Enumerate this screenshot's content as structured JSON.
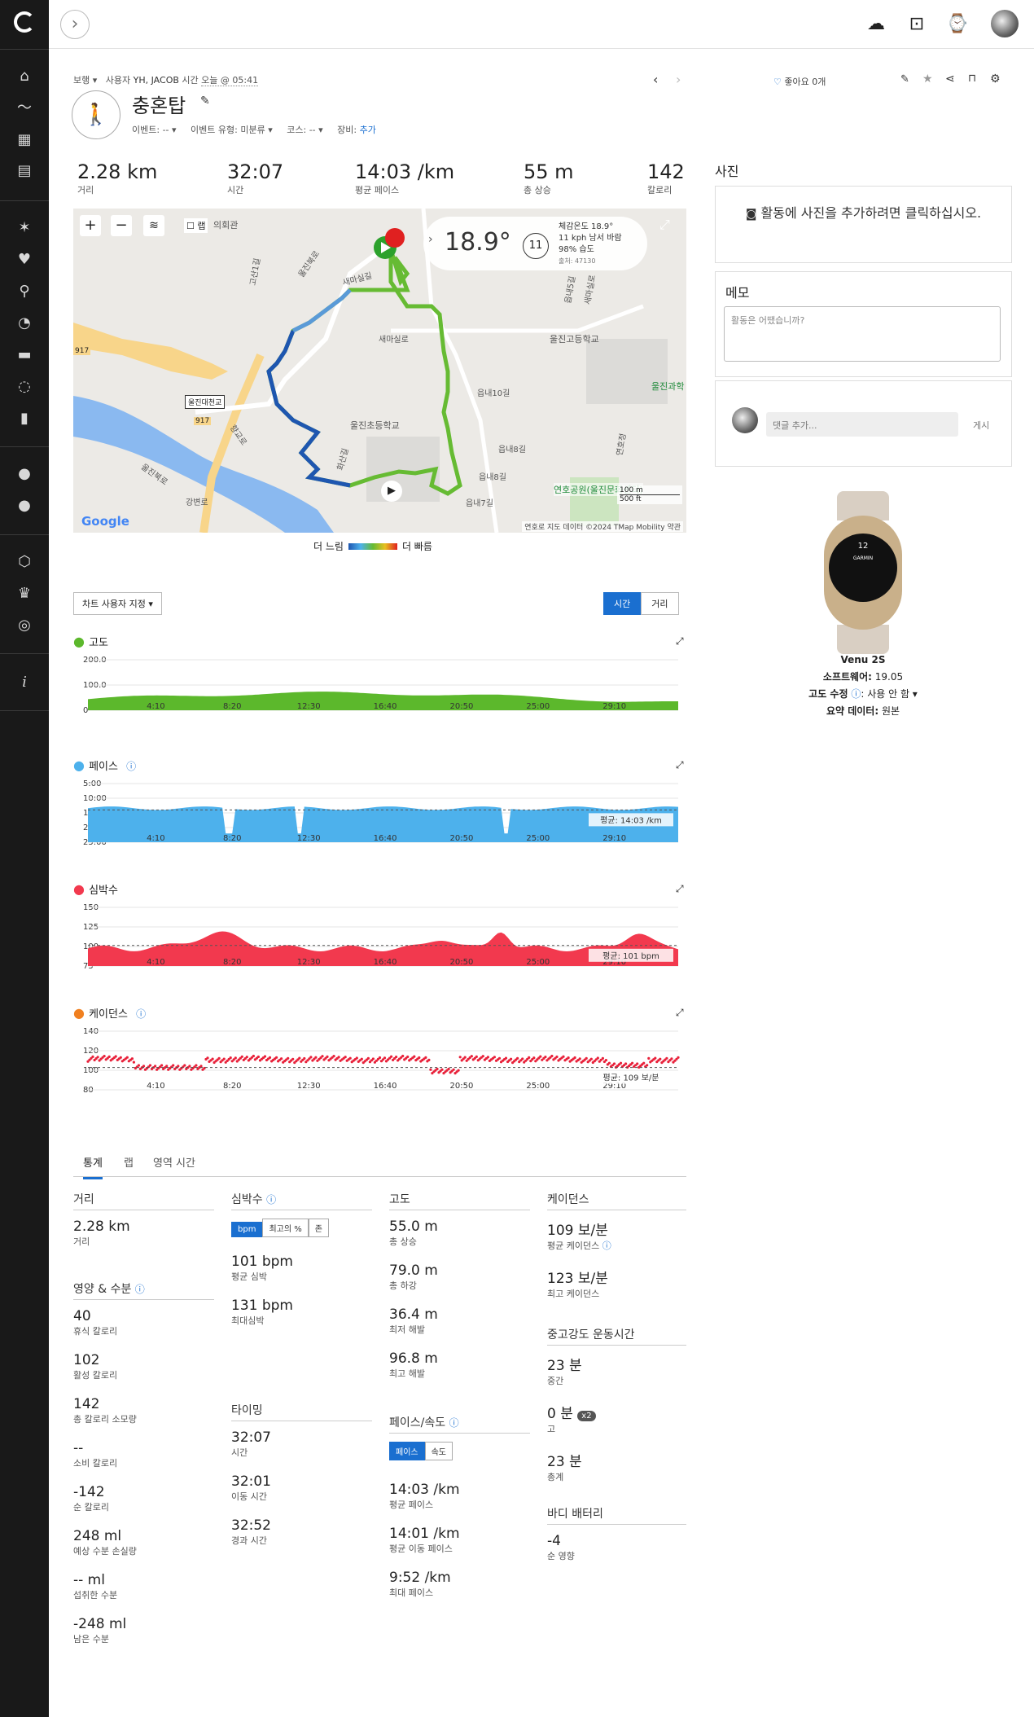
{
  "header": {
    "breadcrumb_type": "보행",
    "by_label": "사용자",
    "user": "YH, JACOB",
    "time_label": "시간",
    "time_value": "오늘 @ 05:41",
    "title": "충혼탑",
    "event_label": "이벤트:",
    "event_value": "--",
    "event_type_label": "이벤트 유형:",
    "event_type_value": "미분류",
    "course_label": "코스:",
    "course_value": "--",
    "gear_label": "장비:",
    "gear_value": "추가",
    "like_label": "좋아요 0개"
  },
  "stats": [
    {
      "value": "2.28 km",
      "label": "거리"
    },
    {
      "value": "32:07",
      "label": "시간"
    },
    {
      "value": "14:03 /km",
      "label": "평균 페이스"
    },
    {
      "value": "55 m",
      "label": "총 상승"
    },
    {
      "value": "142",
      "label": "칼로리"
    }
  ],
  "map": {
    "weather_temp": "18.9°",
    "weather_feels": "체감온도 18.9°",
    "weather_wind": "11 kph 남서 바람",
    "weather_humidity": "98% 습도",
    "weather_source": "출처: 47130",
    "wind_speed": "11",
    "lap_label": "랩",
    "scale_m": "100 m",
    "scale_ft": "500 ft",
    "google": "Google",
    "attribution": "연호로   지도 데이터 ©2024 TMap Mobility   약관",
    "legend_slow": "더 느림",
    "legend_fast": "더 빠름",
    "places": [
      "의회관",
      "새마실로",
      "울진고등학교",
      "읍내10길",
      "울진초등학교",
      "읍내8길",
      "읍내8길",
      "읍내7길",
      "울진대천교",
      "연호공원(울진문화센터)",
      "울진과학",
      "917",
      "917",
      "고산1길",
      "울진북로",
      "새마실길",
      "읍내5길",
      "새마실로",
      "강변로",
      "울진북로",
      "연호정",
      "향교로",
      "화산길"
    ]
  },
  "chart_controls": {
    "customize": "차트 사용자 지정 ▾",
    "time": "시간",
    "distance": "거리"
  },
  "charts": {
    "x_ticks": [
      "4:10",
      "8:20",
      "12:30",
      "16:40",
      "20:50",
      "25:00",
      "29:10"
    ],
    "elevation": {
      "title": "고도",
      "y_ticks": [
        "200.0",
        "100.0",
        "0"
      ]
    },
    "pace": {
      "title": "페이스",
      "y_ticks": [
        "5:00",
        "10:00",
        "15:00",
        "20:00",
        "25:00"
      ],
      "avg": "평균: 14:03 /km"
    },
    "hr": {
      "title": "심박수",
      "y_ticks": [
        "150",
        "125",
        "100",
        "75"
      ],
      "avg": "평균: 101 bpm"
    },
    "cadence": {
      "title": "케이던스",
      "y_ticks": [
        "140",
        "120",
        "100",
        "80"
      ],
      "avg": "평균: 109 보/분"
    }
  },
  "tabs": {
    "stats": "통계",
    "laps": "랩",
    "zones": "영역 시간"
  },
  "summary": {
    "distance": {
      "head": "거리",
      "items": [
        {
          "v": "2.28 km",
          "l": "거리"
        }
      ]
    },
    "nutrition": {
      "head": "영양 & 수분",
      "items": [
        {
          "v": "40",
          "l": "휴식 칼로리"
        },
        {
          "v": "102",
          "l": "활성 칼로리"
        },
        {
          "v": "142",
          "l": "총 칼로리 소모량"
        },
        {
          "v": "--",
          "l": "소비 칼로리"
        },
        {
          "v": "-142",
          "l": "순 칼로리"
        },
        {
          "v": "248 ml",
          "l": "예상 수분 손실량"
        },
        {
          "v": "-- ml",
          "l": "섭취한 수분"
        },
        {
          "v": "-248 ml",
          "l": "남은 수분"
        }
      ]
    },
    "hr": {
      "head": "심박수",
      "btns": [
        "bpm",
        "최고의 %",
        "존"
      ],
      "items": [
        {
          "v": "101 bpm",
          "l": "평균 심박"
        },
        {
          "v": "131 bpm",
          "l": "최대심박"
        }
      ]
    },
    "timing": {
      "head": "타이밍",
      "items": [
        {
          "v": "32:07",
          "l": "시간"
        },
        {
          "v": "32:01",
          "l": "이동 시간"
        },
        {
          "v": "32:52",
          "l": "경과 시간"
        }
      ]
    },
    "elevation": {
      "head": "고도",
      "items": [
        {
          "v": "55.0 m",
          "l": "총 상승"
        },
        {
          "v": "79.0 m",
          "l": "총 하강"
        },
        {
          "v": "36.4 m",
          "l": "최저 해발"
        },
        {
          "v": "96.8 m",
          "l": "최고 해발"
        }
      ]
    },
    "pace": {
      "head": "페이스/속도",
      "btns": [
        "페이스",
        "속도"
      ],
      "items": [
        {
          "v": "14:03 /km",
          "l": "평균 페이스"
        },
        {
          "v": "14:01 /km",
          "l": "평균 이동 페이스"
        },
        {
          "v": "9:52 /km",
          "l": "최대 페이스"
        }
      ]
    },
    "cadence": {
      "head": "케이던스",
      "items": [
        {
          "v": "109 보/분",
          "l": "평균 케이던스"
        },
        {
          "v": "123 보/분",
          "l": "최고 케이던스"
        }
      ]
    },
    "intensity": {
      "head": "중고강도 운동시간",
      "items": [
        {
          "v": "23 분",
          "l": "중간"
        },
        {
          "v": "0 분",
          "l": "고"
        },
        {
          "v": "23 분",
          "l": "총계"
        }
      ],
      "x2": "x2"
    },
    "battery": {
      "head": "바디 배터리",
      "items": [
        {
          "v": "-4",
          "l": "순 영향"
        }
      ]
    }
  },
  "right": {
    "photos_title": "사진",
    "photos_add": "활동에 사진을 추가하려면 클릭하십시오.",
    "memo_title": "메모",
    "memo_placeholder": "활동은 어땠습니까?",
    "comment_placeholder": "댓글 추가...",
    "post": "게시",
    "device_name": "Venu 2S",
    "software_label": "소프트웨어:",
    "software_value": "19.05",
    "elev_corr_label": "고도 수정",
    "elev_corr_value": ": 사용 안 함 ▾",
    "summary_label": "요약 데이터:",
    "summary_value": "원본",
    "watch_time": "12",
    "watch_label": "GARMIN"
  },
  "colors": {
    "elev": "#5cb82c",
    "pace": "#4db1ec",
    "hr": "#f2394e",
    "cadence": "#e8213a",
    "accent": "#1a6fd0"
  }
}
